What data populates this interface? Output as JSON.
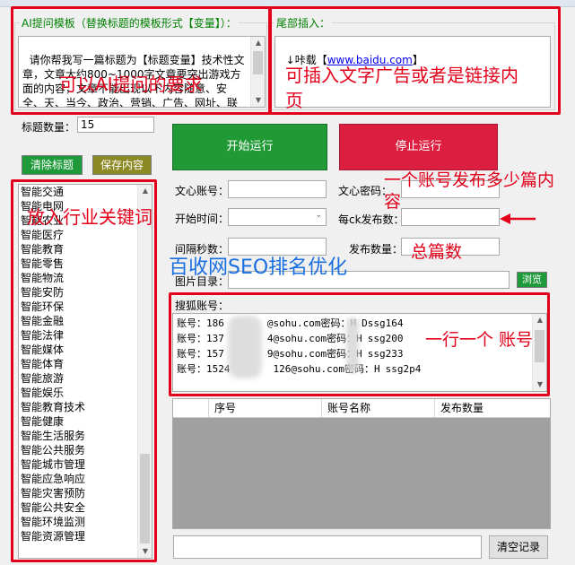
{
  "template_group": {
    "title": "AI提问模板（替换标题的模板形式【变量】）：",
    "text": "请你帮我写一篇标题为【标题变量】技术性文章，文章大约800~1000字文章要突出游戏方面的内容，文章不能出现以下内容随意、安全、天、当今、政治、营销、广告、网址、联系方式、广告推广信息、营销推广、广告软文、医"
  },
  "tail_group": {
    "title": "尾部插入：",
    "prefix": "↓咔载【",
    "link": "www.baidu.com",
    "suffix": "】"
  },
  "title_count": {
    "label": "标题数量：",
    "value": "15"
  },
  "buttons": {
    "clear_titles": "清除标题",
    "save_content": "保存内容",
    "start": "开始运行",
    "stop": "停止运行",
    "browse": "浏览",
    "clear_log": "清空记录"
  },
  "form": {
    "account_label": "文心账号：",
    "password_label": "文心密码：",
    "start_time_label": "开始时间：",
    "per_account_label": "每ck发布数：",
    "interval_label": "间隔秒数：",
    "publish_count_label": "发布数量：",
    "image_dir_label": "图片目录：",
    "sohu_label": "搜狐账号："
  },
  "keywords": [
    "智能交通",
    "智能电网",
    "智能农业",
    "智能医疗",
    "智能教育",
    "智能零售",
    "智能物流",
    "智能安防",
    "智能环保",
    "智能金融",
    "智能法律",
    "智能媒体",
    "智能体育",
    "智能旅游",
    "智能娱乐",
    "智能教育技术",
    "智能健康",
    "智能生活服务",
    "智能公共服务",
    "智能城市管理",
    "智能应急响应",
    "智能灾害预防",
    "智能公共安全",
    "智能环境监测",
    "智能资源管理"
  ],
  "accounts": [
    {
      "prefix": "账号：186",
      "mid": "@sohu.com密码：H",
      "end": "Dssg164"
    },
    {
      "prefix": "账号：137",
      "mid": "4@sohu.com密码：H",
      "end": "ssg200"
    },
    {
      "prefix": "账号：157",
      "mid": "9@sohu.com密码：H",
      "end": "ssg233"
    },
    {
      "prefix": "账号：1524",
      "mid": "126@sohu.com密码：H",
      "end": "ssg2p4"
    }
  ],
  "grid_columns": [
    "序号",
    "账号名称",
    "发布数量"
  ],
  "annotations": {
    "template_note": "可以AI提问的要求",
    "tail_note": "可插入文字广告或者是链接内页",
    "per_account_note_1": "一个账号发布多少篇内",
    "per_account_note_2": "容",
    "total_note": "总篇数",
    "keywords_note": "放入行业关键词",
    "accounts_note": "一行一个 账号",
    "watermark": "百收网SEO排名优化"
  }
}
